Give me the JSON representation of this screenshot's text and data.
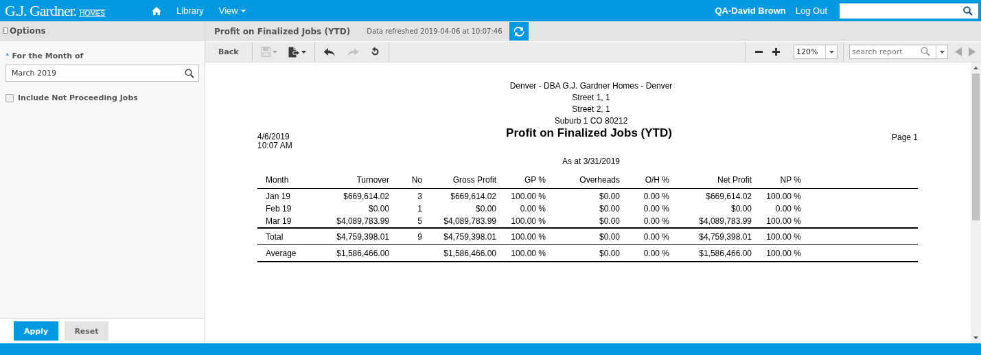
{
  "header": {
    "logo": "G.J. Gardner.",
    "logo_sub": "HOMES",
    "nav": [
      {
        "kind": "home"
      },
      {
        "kind": "link",
        "label": "Library"
      },
      {
        "kind": "menu",
        "label": "View"
      }
    ],
    "user": "QA-David Brown",
    "logout": "Log Out"
  },
  "options": {
    "title": "Options",
    "fields": [
      {
        "kind": "lookup",
        "label": "For the Month of",
        "required_mark": "*",
        "value": "March 2019"
      },
      {
        "kind": "checkbox",
        "label": "Include Not Proceeding Jobs",
        "checked": false
      }
    ],
    "buttons": [
      {
        "label": "Apply",
        "primary": true
      },
      {
        "label": "Reset",
        "primary": false
      }
    ]
  },
  "report_bar": {
    "title": "Profit on Finalized Jobs (YTD)",
    "refreshed": "Data refreshed 2019-04-06 at 10:07:46"
  },
  "toolbar": {
    "back": "Back",
    "tools": [
      {
        "kind": "save",
        "disabled": true,
        "menu": true
      },
      {
        "kind": "export",
        "disabled": false,
        "menu": true
      },
      {
        "kind": "undo",
        "disabled": false,
        "menu": false
      },
      {
        "kind": "redo",
        "disabled": true,
        "menu": false
      },
      {
        "kind": "reset",
        "disabled": false,
        "menu": false
      }
    ],
    "zoom": "120%",
    "search": {
      "placeholder": "search report"
    },
    "prev_disabled": true,
    "next_disabled": true
  },
  "report": {
    "company_lines": [
      "Denver - DBA G.J. Gardner Homes - Denver",
      "Street 1, 1",
      "Street 2, 1",
      "Suburb 1 CO 80212"
    ],
    "date": "4/6/2019",
    "time": "10:07 AM",
    "title": "Profit on Finalized Jobs (YTD)",
    "page": "Page 1",
    "as_at": "As at 3/31/2019",
    "columns": [
      "Month",
      "Turnover",
      "No",
      "Gross Profit",
      "GP %",
      "Overheads",
      "O/H %",
      "Net Profit",
      "NP %"
    ],
    "rows": [
      {
        "kind": "data",
        "cells": [
          "Jan 19",
          "$669,614.02",
          "3",
          "$669,614.02",
          "100.00 %",
          "$0.00",
          "0.00 %",
          "$669,614.02",
          "100.00 %"
        ]
      },
      {
        "kind": "data",
        "cells": [
          "Feb 19",
          "$0.00",
          "1",
          "$0.00",
          "0.00 %",
          "$0.00",
          "0.00 %",
          "$0.00",
          "0.00 %"
        ]
      },
      {
        "kind": "data",
        "cells": [
          "Mar 19",
          "$4,089,783.99",
          "5",
          "$4,089,783.99",
          "100.00 %",
          "$0.00",
          "0.00 %",
          "$4,089,783.99",
          "100.00 %"
        ]
      },
      {
        "kind": "total",
        "cells": [
          "Total",
          "$4,759,398.01",
          "9",
          "$4,759,398.01",
          "100.00 %",
          "$0.00",
          "0.00 %",
          "$4,759,398.01",
          "100.00 %"
        ]
      },
      {
        "kind": "average",
        "cells": [
          "Average",
          "$1,586,466.00",
          null,
          "$1,586,466.00",
          "100.00 %",
          "$0.00",
          "0.00 %",
          "$1,586,466.00",
          "100.00 %"
        ]
      }
    ]
  }
}
